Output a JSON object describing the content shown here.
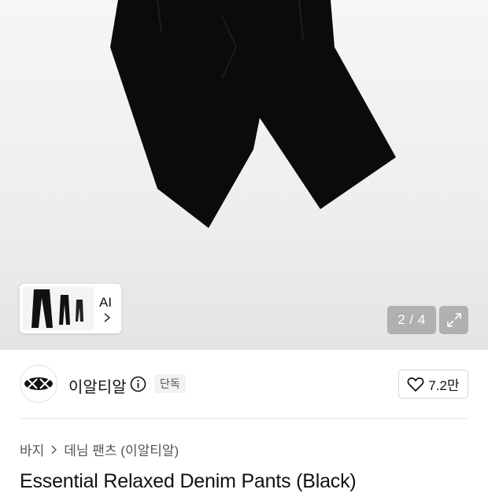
{
  "gallery": {
    "ai_label": "AI",
    "counter": "2 / 4",
    "icons": {
      "ai_chevron": "chevron-right-icon",
      "expand": "expand-icon"
    }
  },
  "brand": {
    "name": "이알티알",
    "badge": "단독",
    "likes": "7.2만",
    "icons": {
      "logo": "brand-logo-icon",
      "info": "info-icon",
      "like": "heart-icon"
    }
  },
  "breadcrumb": {
    "category": "바지",
    "subcategory": "데님 팬츠 (이알티알)",
    "separator_icon": "chevron-right-icon"
  },
  "product": {
    "title": "Essential Relaxed Denim Pants (Black)"
  }
}
